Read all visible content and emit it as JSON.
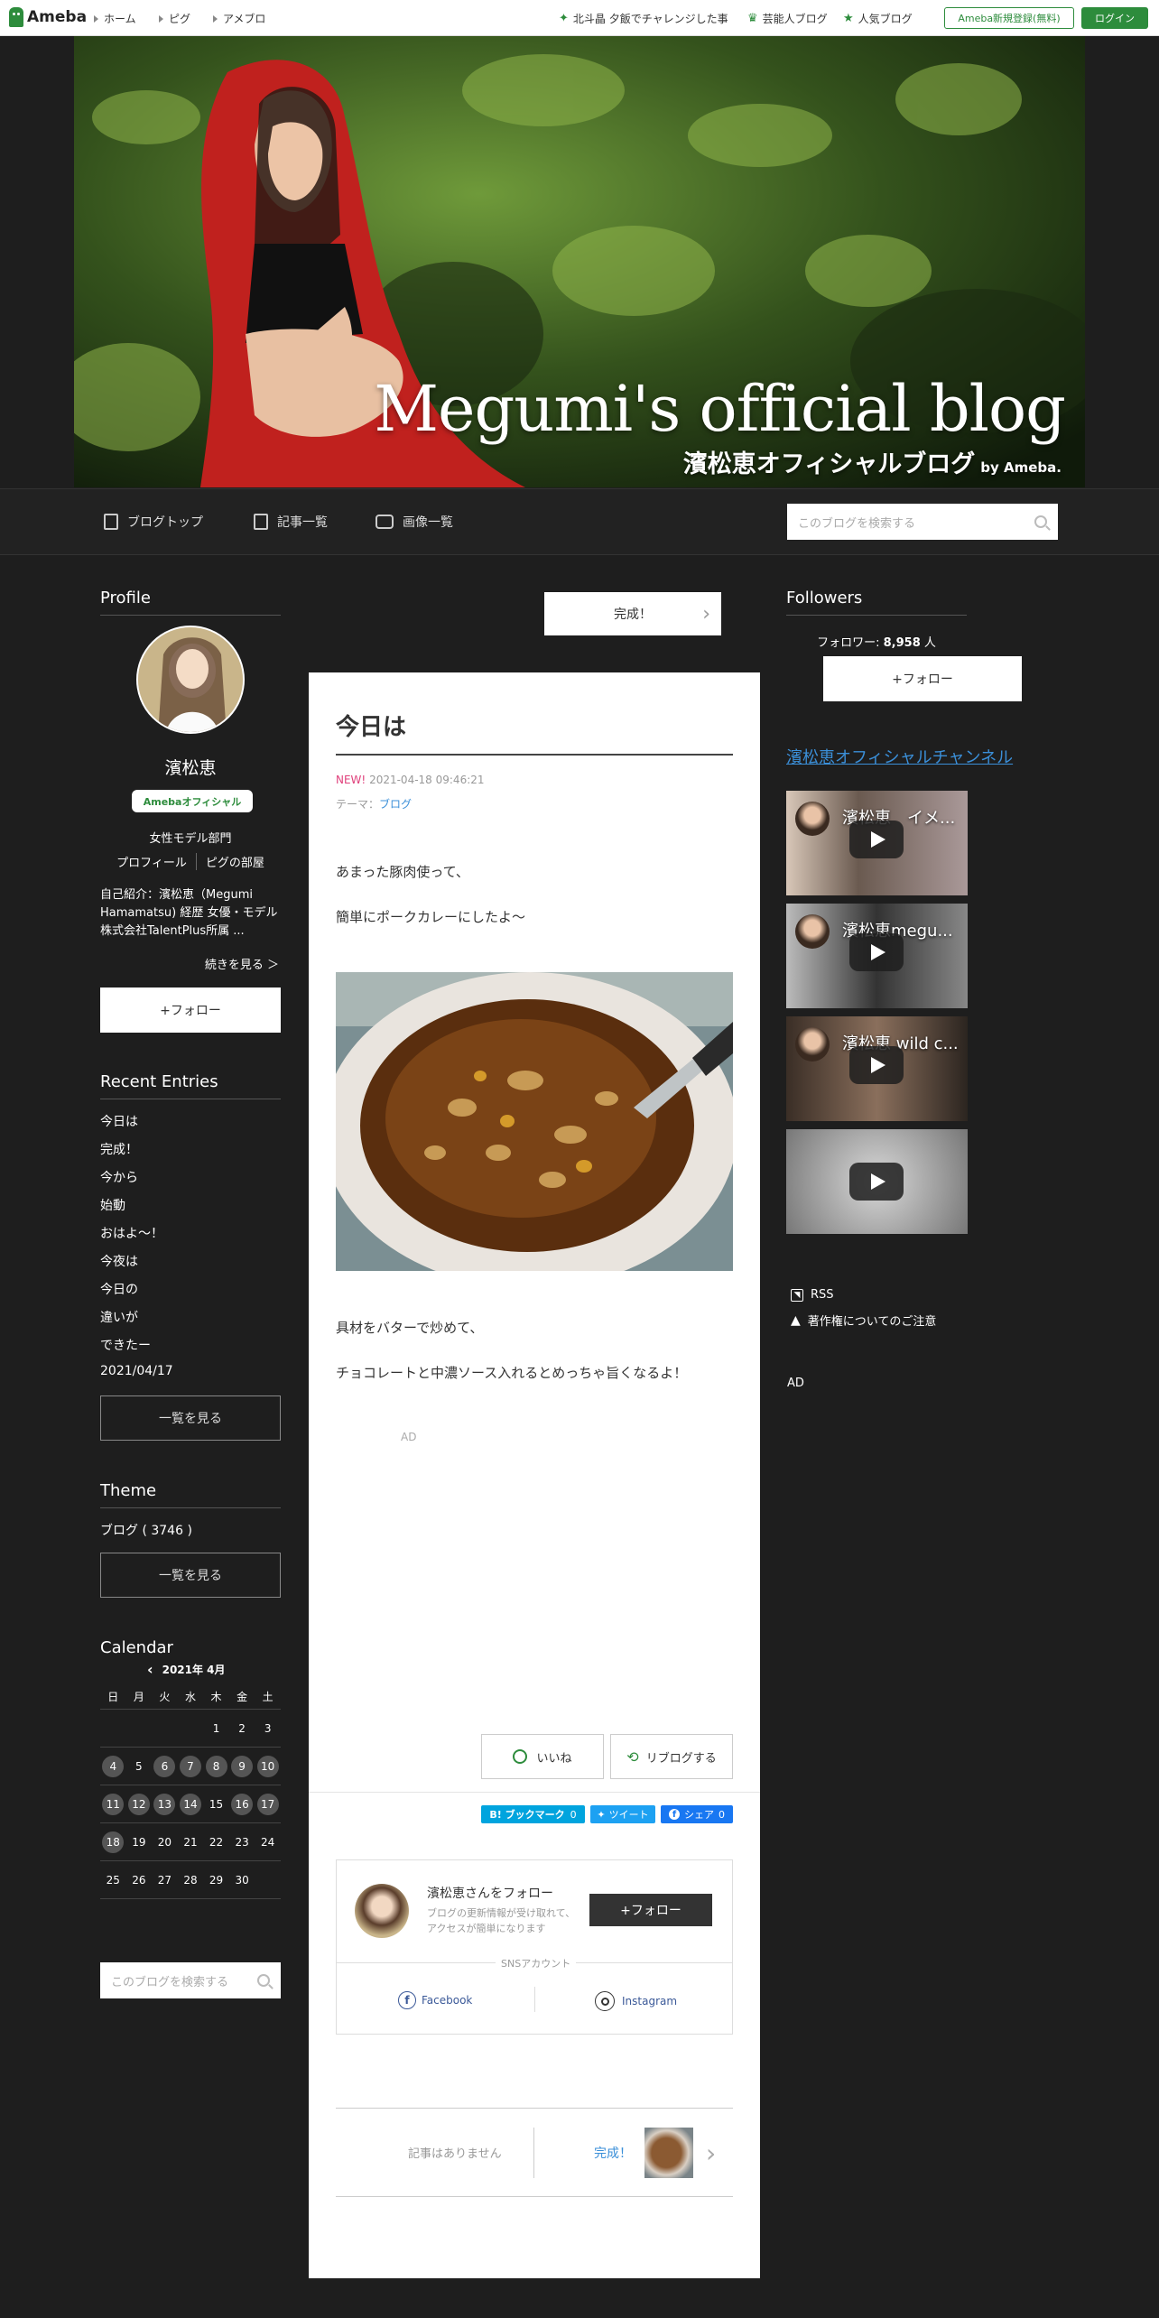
{
  "topbar": {
    "logo": "Ameba",
    "nav": [
      "ホーム",
      "ピグ",
      "アメブロ"
    ],
    "right_links": [
      "北斗晶 夕飯でチャレンジした事",
      "芸能人ブログ",
      "人気ブログ"
    ],
    "register": "Ameba新規登録(無料)",
    "login": "ログイン"
  },
  "header": {
    "title": "Megumi's official blog",
    "subtitle": "濱松恵オフィシャルブログ",
    "byline": "by Ameba."
  },
  "navbar": {
    "items": [
      "ブログトップ",
      "記事一覧",
      "画像一覧"
    ],
    "search_placeholder": "このブログを検索する"
  },
  "profile": {
    "heading": "Profile",
    "name": "濱松恵",
    "badge": "Amebaオフィシャル",
    "category": "女性モデル部門",
    "links": [
      "プロフィール",
      "ピグの部屋"
    ],
    "intro": "自己紹介：濱松恵（Megumi Hamamatsu) 経歴 女優・モデル 株式会社TalentPlus所属 ...",
    "more": "続きを見る ＞",
    "follow": "+フォロー"
  },
  "recent": {
    "heading": "Recent Entries",
    "items": [
      "今日は",
      "完成！",
      "今から",
      "始動",
      "おはよ～！",
      "今夜は",
      "今日の",
      "違いが",
      "できたー",
      "2021/04/17"
    ],
    "all": "一覧を見る"
  },
  "theme": {
    "heading": "Theme",
    "item": "ブログ ( 3746 )",
    "all": "一覧を見る"
  },
  "calendar": {
    "heading": "Calendar",
    "month": "2021年 4月",
    "weekdays": [
      "日",
      "月",
      "火",
      "水",
      "木",
      "金",
      "土"
    ],
    "weeks": [
      [
        "",
        "",
        "",
        "",
        "1",
        "2",
        "3"
      ],
      [
        "4",
        "5",
        "6",
        "7",
        "8",
        "9",
        "10"
      ],
      [
        "11",
        "12",
        "13",
        "14",
        "15",
        "16",
        "17"
      ],
      [
        "18",
        "19",
        "20",
        "21",
        "22",
        "23",
        "24"
      ],
      [
        "25",
        "26",
        "27",
        "28",
        "29",
        "30",
        ""
      ]
    ],
    "highlighted": [
      "4",
      "6",
      "7",
      "8",
      "9",
      "10",
      "11",
      "12",
      "13",
      "14",
      "16",
      "17",
      "18"
    ]
  },
  "left_search_placeholder": "このブログを検索する",
  "prev_next_top": "完成！",
  "article": {
    "title": "今日は",
    "new_label": "NEW!",
    "date": "2021-04-18 09:46:21",
    "theme_label": "テーマ：",
    "theme": "ブログ",
    "p1": "あまった豚肉使って、",
    "p2": "簡単にポークカレーにしたよ～",
    "p3": "具材をバターで炒めて、",
    "p4": "チョコレートと中濃ソース入れるとめっちゃ旨くなるよ！",
    "ad": "AD",
    "like": "いいね",
    "reblog": "リブログする",
    "hatena": "B! ブックマーク",
    "hatena_count": "0",
    "tweet": "ツイート",
    "share": "シェア",
    "share_count": "0",
    "follow_title": "濱松恵さんをフォロー",
    "follow_desc": "ブログの更新情報が受け取れて、アクセスが簡単になります",
    "follow_btn": "+フォロー",
    "sns_label": "SNSアカウント",
    "facebook": "Facebook",
    "instagram": "Instagram",
    "prev_none": "記事はありません",
    "next": "完成！"
  },
  "followers": {
    "heading": "Followers",
    "label": "フォロワー: ",
    "count": "8,958",
    "unit": " 人",
    "follow": "+フォロー"
  },
  "channel": "濱松恵オフィシャルチャンネル",
  "videos": [
    "濱松恵　イメ...",
    "濱松恵megu...",
    "濱松恵 wild c...",
    ""
  ],
  "rss": "RSS",
  "copyright": "著作権についてのご注意",
  "right_ad": "AD",
  "colors": {
    "accent": "#2d8c3c",
    "link": "#3b8fd8",
    "dark_bg": "#1e1e1e"
  }
}
